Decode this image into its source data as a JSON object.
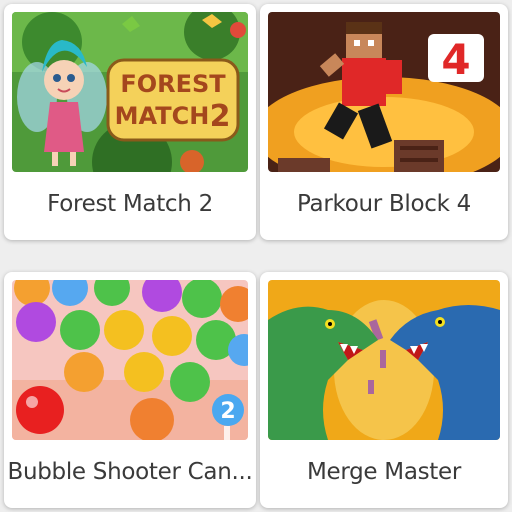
{
  "games": [
    {
      "title": "Forest Match 2",
      "thumb_text": [
        "FOREST",
        "MATCH",
        "2"
      ]
    },
    {
      "title": "Parkour Block 4",
      "thumb_text": [
        "4"
      ]
    },
    {
      "title": "Bubble Shooter Can...",
      "thumb_text": [
        "2"
      ]
    },
    {
      "title": "Merge Master",
      "thumb_text": []
    }
  ],
  "colors": {
    "page_bg": "#eeeeee",
    "card_bg": "#ffffff",
    "title_text": "#3a3a3a"
  }
}
